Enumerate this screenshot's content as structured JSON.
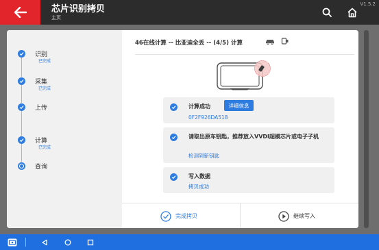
{
  "app": {
    "title": "芯片识别拷贝",
    "subtitle": "主页",
    "version": "V1.5.2"
  },
  "icons": {
    "back": "back-arrow-icon",
    "search": "search-icon",
    "home": "home-icon"
  },
  "steps": [
    {
      "label": "识别",
      "sub": "已完成",
      "state": "done"
    },
    {
      "label": "采集",
      "sub": "已完成",
      "state": "done"
    },
    {
      "label": "上传",
      "sub": "",
      "state": "done"
    },
    {
      "label": "计算",
      "sub": "已完成",
      "state": "done"
    },
    {
      "label": "查询",
      "sub": "",
      "state": "current"
    }
  ],
  "main": {
    "title": "46在线计算 -- 比亚迪全丢 -- (4/5) 计算",
    "cards": [
      {
        "title": "计算成功",
        "button": "详细信息",
        "sub": "0F2F926DA518"
      },
      {
        "title": "请取出原车钥匙，推荐放入VVDI超模芯片或电子子机",
        "sub": "检测到新钥匙"
      },
      {
        "title": "写入数据",
        "sub": "拷贝成功"
      }
    ],
    "finish_label": "完成拷贝",
    "continue_label": "继续写入"
  },
  "colors": {
    "accent": "#2f7ce0",
    "back_button": "#e2252b",
    "app_bar": "#2c2c2c",
    "nav_bar": "#1f6fe0"
  }
}
